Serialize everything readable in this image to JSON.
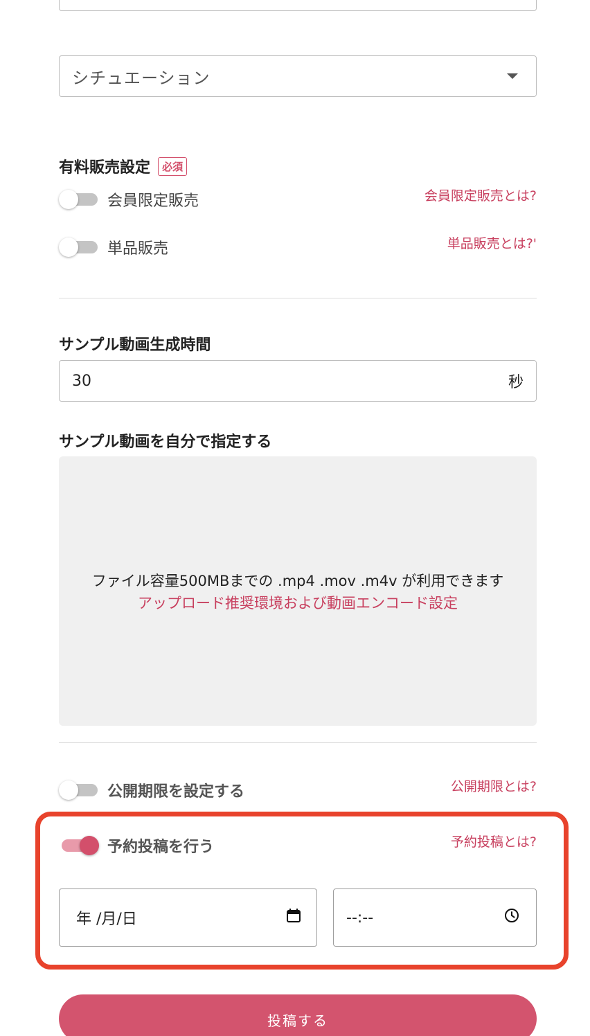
{
  "situation_select": {
    "placeholder": "シチュエーション"
  },
  "paid_sales": {
    "title": "有料販売設定",
    "required_badge": "必須",
    "member_only": {
      "label": "会員限定販売",
      "help": "会員限定販売とは?",
      "enabled": false
    },
    "single_item": {
      "label": "単品販売",
      "help": "単品販売とは?'",
      "enabled": false
    }
  },
  "sample_duration": {
    "title": "サンプル動画生成時間",
    "value": "30",
    "unit": "秒"
  },
  "sample_custom": {
    "title": "サンプル動画を自分で指定する",
    "upload_text": "ファイル容量500MBまでの .mp4 .mov .m4v が利用できます",
    "upload_link": "アップロード推奨環境および動画エンコード設定"
  },
  "publish_limit": {
    "label": "公開期限を設定する",
    "help": "公開期限とは?",
    "enabled": false
  },
  "scheduled_post": {
    "label": "予約投稿を行う",
    "help": "予約投稿とは?",
    "enabled": true,
    "date_placeholder": "年 /月/日",
    "time_placeholder": "--:--"
  },
  "submit": {
    "label": "投稿する"
  },
  "colors": {
    "accent": "#d3546e",
    "highlight": "#e8432c",
    "link": "#c8405f"
  },
  "icons": {
    "calendar": "calendar-icon",
    "clock": "clock-icon",
    "dropdown": "chevron-down-icon"
  }
}
